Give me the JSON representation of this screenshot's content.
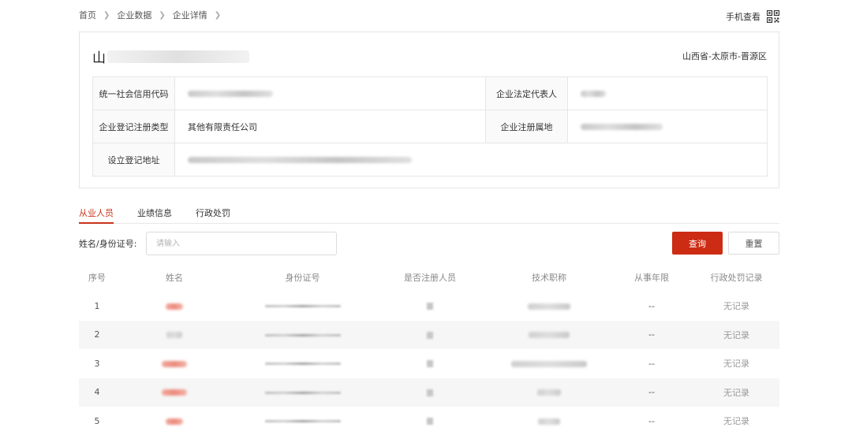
{
  "breadcrumb": [
    "首页",
    "企业数据",
    "企业详情"
  ],
  "mobile_view_label": "手机查看",
  "company": {
    "name_visible": "山",
    "region": "山西省-太原市-晋源区",
    "fields": {
      "credit_code_label": "统一社会信用代码",
      "legal_rep_label": "企业法定代表人",
      "reg_type_label": "企业登记注册类型",
      "reg_type_value": "其他有限责任公司",
      "reg_place_label": "企业注册属地",
      "address_label": "设立登记地址"
    }
  },
  "tabs": [
    "从业人员",
    "业绩信息",
    "行政处罚"
  ],
  "active_tab": 0,
  "search": {
    "label": "姓名/身份证号:",
    "placeholder": "请输入",
    "query_button": "查询",
    "reset_button": "重置"
  },
  "table": {
    "headers": [
      "序号",
      "姓名",
      "身份证号",
      "是否注册人员",
      "技术职称",
      "从事年限",
      "行政处罚记录"
    ],
    "rows": [
      {
        "index": "1",
        "years": "--",
        "penalty": "无记录"
      },
      {
        "index": "2",
        "years": "--",
        "penalty": "无记录"
      },
      {
        "index": "3",
        "years": "--",
        "penalty": "无记录"
      },
      {
        "index": "4",
        "years": "--",
        "penalty": "无记录"
      },
      {
        "index": "5",
        "years": "--",
        "penalty": "无记录"
      }
    ]
  },
  "colors": {
    "accent": "#cc2c14",
    "active_tab": "#c9341c",
    "row_stripe": "#f6f6f6"
  }
}
